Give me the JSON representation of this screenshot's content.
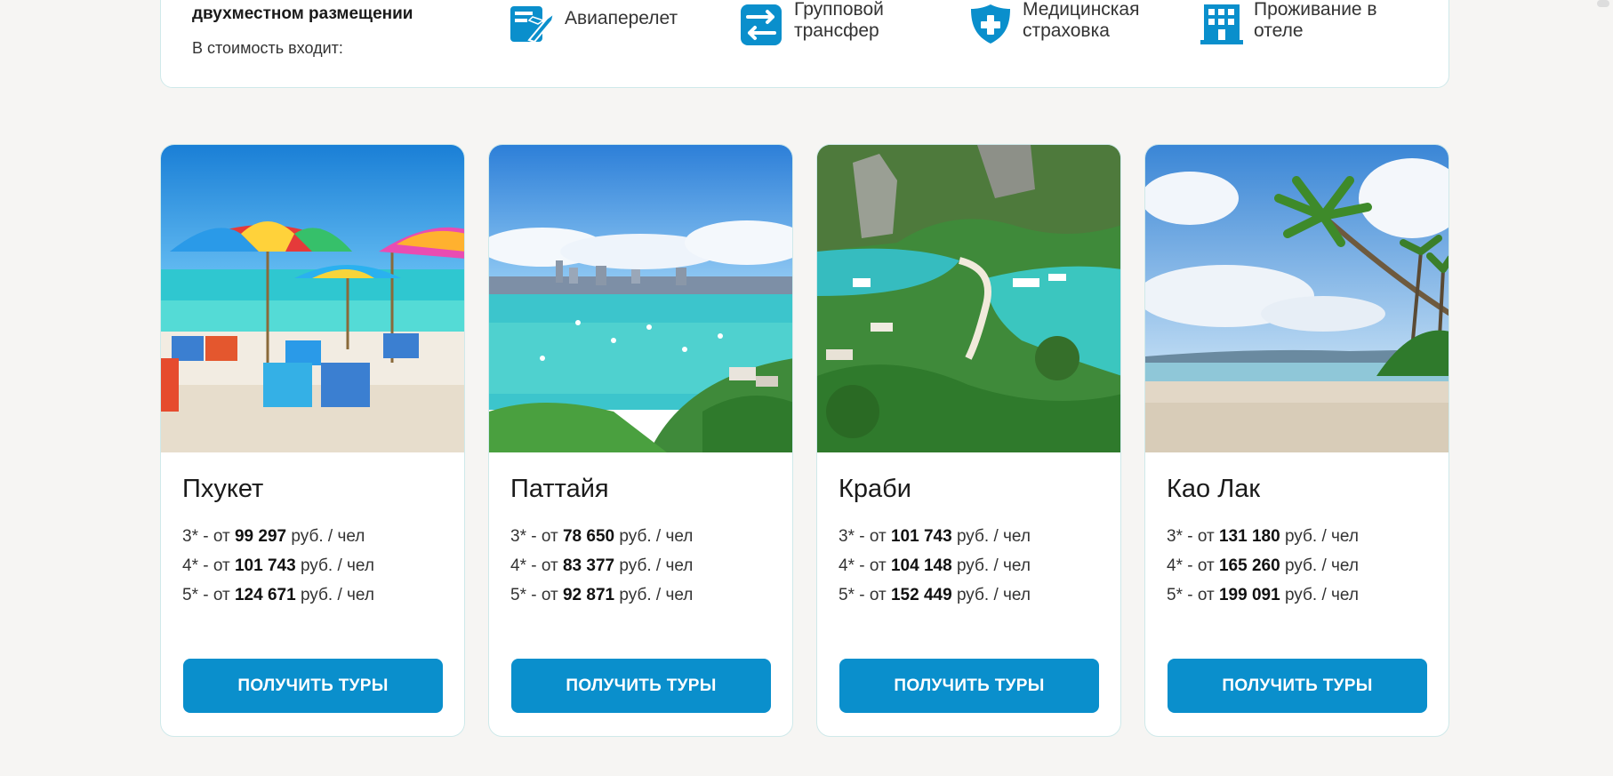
{
  "info": {
    "title": "двухместном размещении",
    "subtitle": "В стоимость входит:",
    "features": [
      {
        "icon": "plane-ticket-icon",
        "lines": [
          "Авиаперелет",
          ""
        ]
      },
      {
        "icon": "transfer-arrows-icon",
        "lines": [
          "Групповой",
          "трансфер"
        ]
      },
      {
        "icon": "medical-shield-icon",
        "lines": [
          "Медицинская",
          "страховка"
        ]
      },
      {
        "icon": "hotel-building-icon",
        "lines": [
          "Проживание в",
          "отеле"
        ]
      }
    ]
  },
  "accent_color": "#0a8fcc",
  "cards": [
    {
      "title": "Пхукет",
      "image": "beach-umbrellas-photo",
      "prices": [
        {
          "prefix": "3* - от ",
          "amount": "99 297",
          "suffix": " руб. / чел"
        },
        {
          "prefix": "4* - от ",
          "amount": "101 743",
          "suffix": " руб. / чел"
        },
        {
          "prefix": "5* - от ",
          "amount": "124 671",
          "suffix": " руб. / чел"
        }
      ],
      "button": "ПОЛУЧИТЬ ТУРЫ"
    },
    {
      "title": "Паттайя",
      "image": "bay-city-photo",
      "prices": [
        {
          "prefix": "3* - от ",
          "amount": "78 650",
          "suffix": " руб. / чел"
        },
        {
          "prefix": "4* - от ",
          "amount": "83 377",
          "suffix": " руб. / чел"
        },
        {
          "prefix": "5* - от ",
          "amount": "92 871",
          "suffix": " руб. / чел"
        }
      ],
      "button": "ПОЛУЧИТЬ ТУРЫ"
    },
    {
      "title": "Краби",
      "image": "island-lagoon-photo",
      "prices": [
        {
          "prefix": "3* - от ",
          "amount": "101 743",
          "suffix": " руб. / чел"
        },
        {
          "prefix": "4* - от ",
          "amount": "104 148",
          "suffix": " руб. / чел"
        },
        {
          "prefix": "5* - от ",
          "amount": "152 449",
          "suffix": " руб. / чел"
        }
      ],
      "button": "ПОЛУЧИТЬ ТУРЫ"
    },
    {
      "title": "Као Лак",
      "image": "palm-beach-photo",
      "prices": [
        {
          "prefix": "3* - от ",
          "amount": "131 180",
          "suffix": " руб. / чел"
        },
        {
          "prefix": "4* - от ",
          "amount": "165 260",
          "suffix": " руб. / чел"
        },
        {
          "prefix": "5* - от ",
          "amount": "199 091",
          "suffix": " руб. / чел"
        }
      ],
      "button": "ПОЛУЧИТЬ ТУРЫ"
    }
  ]
}
